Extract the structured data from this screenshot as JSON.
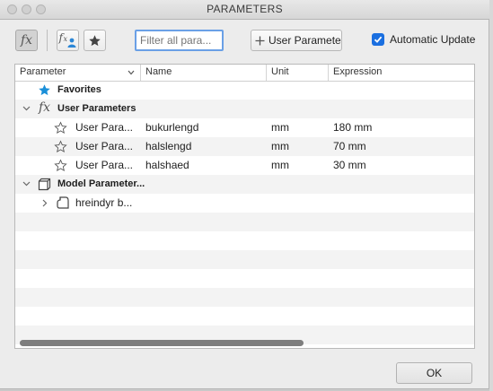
{
  "window": {
    "title": "PARAMETERS"
  },
  "toolbar": {
    "filter_placeholder": "Filter all para...",
    "add_button_label": "User Paramete",
    "auto_update_label": "Automatic Update",
    "auto_update_checked": true
  },
  "columns": {
    "parameter": "Parameter",
    "name": "Name",
    "unit": "Unit",
    "expression": "Expression"
  },
  "tree": {
    "favorites": "Favorites",
    "user_parameters": "User Parameters",
    "model_parameters": "Model Parameter...",
    "model_child": "hreindyr b..."
  },
  "user_params": [
    {
      "label": "User Para...",
      "name": "bukurlengd",
      "unit": "mm",
      "expression": "180 mm"
    },
    {
      "label": "User Para...",
      "name": "halslengd",
      "unit": "mm",
      "expression": "70 mm"
    },
    {
      "label": "User Para...",
      "name": "halshaed",
      "unit": "mm",
      "expression": "30 mm"
    }
  ],
  "footer": {
    "ok_label": "OK"
  },
  "colors": {
    "accent": "#1a6fe0",
    "favorite_star": "#1a8fd8"
  }
}
